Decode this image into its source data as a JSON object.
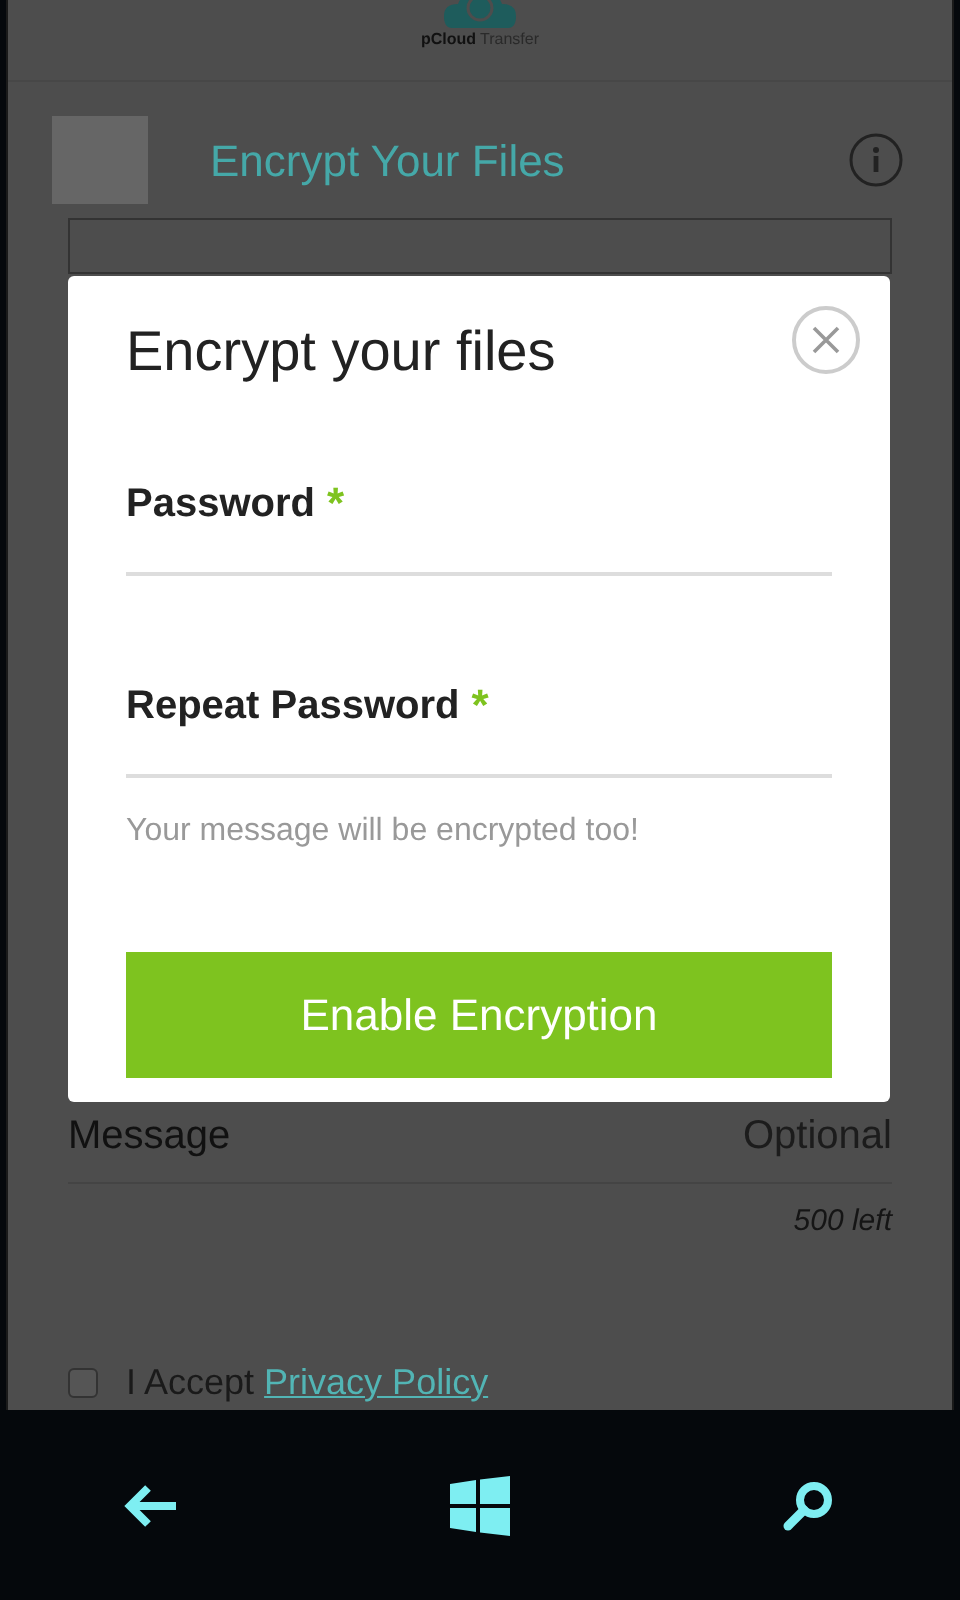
{
  "header": {
    "brand": "pCloud",
    "brand_suffix": "Transfer"
  },
  "page": {
    "title": "Encrypt Your Files"
  },
  "message": {
    "label": "Message",
    "placeholder": "Optional",
    "counter": "500 left"
  },
  "consent": {
    "text": "I Accept",
    "link": "Privacy Policy",
    "checked": false
  },
  "dialog": {
    "title": "Encrypt your files",
    "fields": [
      {
        "label": "Password",
        "required_mark": "*"
      },
      {
        "label": "Repeat Password",
        "required_mark": "*"
      }
    ],
    "note": "Your message will be encrypted too!",
    "button": "Enable Encryption"
  }
}
